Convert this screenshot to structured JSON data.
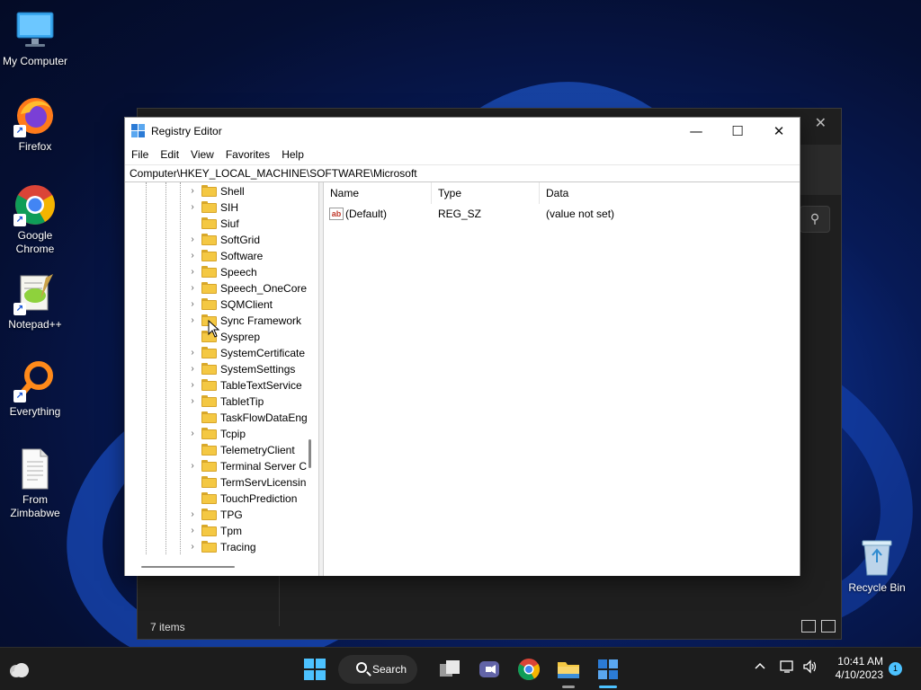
{
  "desktop": {
    "icons": [
      {
        "label": "My Computer",
        "icon": "monitor-icon"
      },
      {
        "label": "Firefox",
        "icon": "firefox-icon"
      },
      {
        "label": "Google Chrome",
        "icon": "chrome-icon"
      },
      {
        "label": "Notepad++",
        "icon": "notepadpp-icon"
      },
      {
        "label": "Everything",
        "icon": "search-magnifier-icon"
      },
      {
        "label": "From Zimbabwe",
        "icon": "document-icon"
      }
    ],
    "recycle_bin": "Recycle Bin"
  },
  "explorer_bg": {
    "status": "7 items"
  },
  "regedit": {
    "title": "Registry Editor",
    "menu": [
      "File",
      "Edit",
      "View",
      "Favorites",
      "Help"
    ],
    "address": "Computer\\HKEY_LOCAL_MACHINE\\SOFTWARE\\Microsoft",
    "tree": [
      {
        "label": "Shell",
        "expandable": true
      },
      {
        "label": "SIH",
        "expandable": true
      },
      {
        "label": "Siuf",
        "expandable": false
      },
      {
        "label": "SoftGrid",
        "expandable": true
      },
      {
        "label": "Software",
        "expandable": true
      },
      {
        "label": "Speech",
        "expandable": true
      },
      {
        "label": "Speech_OneCore",
        "expandable": true
      },
      {
        "label": "SQMClient",
        "expandable": true
      },
      {
        "label": "Sync Framework",
        "expandable": true
      },
      {
        "label": "Sysprep",
        "expandable": false
      },
      {
        "label": "SystemCertificate",
        "expandable": true
      },
      {
        "label": "SystemSettings",
        "expandable": true
      },
      {
        "label": "TableTextService",
        "expandable": true
      },
      {
        "label": "TabletTip",
        "expandable": true
      },
      {
        "label": "TaskFlowDataEng",
        "expandable": false
      },
      {
        "label": "Tcpip",
        "expandable": true
      },
      {
        "label": "TelemetryClient",
        "expandable": false
      },
      {
        "label": "Terminal Server C",
        "expandable": true
      },
      {
        "label": "TermServLicensin",
        "expandable": false
      },
      {
        "label": "TouchPrediction",
        "expandable": false
      },
      {
        "label": "TPG",
        "expandable": true
      },
      {
        "label": "Tpm",
        "expandable": true
      },
      {
        "label": "Tracing",
        "expandable": true
      }
    ],
    "columns": {
      "name": "Name",
      "type": "Type",
      "data": "Data"
    },
    "values": [
      {
        "name": "(Default)",
        "type": "REG_SZ",
        "data": "(value not set)"
      }
    ]
  },
  "taskbar": {
    "search_label": "Search",
    "time": "10:41 AM",
    "date": "4/10/2023",
    "notification_count": "1"
  },
  "colors": {
    "accent": "#0067c0",
    "taskbar_bg": "#1c1c1c",
    "folder": "#f4c843"
  }
}
